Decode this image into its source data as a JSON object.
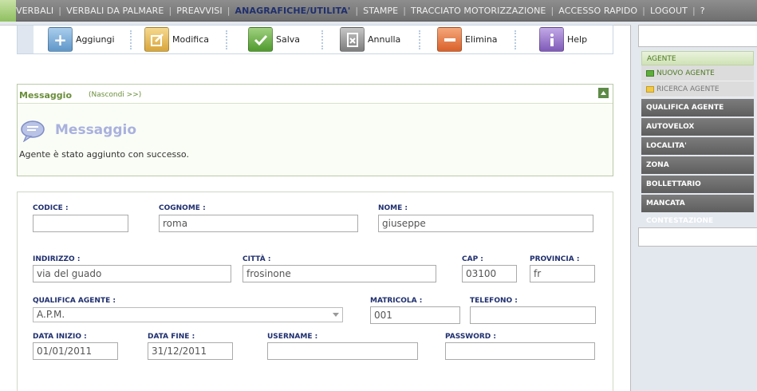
{
  "nav": {
    "items": [
      {
        "label": "VERBALI",
        "active": false
      },
      {
        "label": "VERBALI DA PALMARE",
        "active": false
      },
      {
        "label": "PREAVVISI",
        "active": false
      },
      {
        "label": "ANAGRAFICHE/UTILITA'",
        "active": true
      },
      {
        "label": "STAMPE",
        "active": false
      },
      {
        "label": "TRACCIATO MOTORIZZAZIONE",
        "active": false
      },
      {
        "label": "ACCESSO RAPIDO",
        "active": false
      },
      {
        "label": "LOGOUT",
        "active": false
      },
      {
        "label": "?",
        "active": false
      }
    ],
    "separator": "|"
  },
  "toolbar": {
    "add_label": "Aggiungi",
    "edit_label": "Modifica",
    "save_label": "Salva",
    "cancel_label": "Annulla",
    "delete_label": "Elimina",
    "help_label": "Help",
    "icons": [
      "plus-icon",
      "edit-icon",
      "checkmark-icon",
      "cancel-document-icon",
      "minus-icon",
      "info-icon"
    ],
    "colors": {
      "add": "#6fa6d4",
      "edit": "#e0b24a",
      "save": "#5fae3c",
      "cancel": "#8c8c8c",
      "delete": "#e2733a",
      "help": "#8f6bc1"
    }
  },
  "message": {
    "header_title": "Messaggio",
    "hide_link": "(Nascondi >>)",
    "title": "Messaggio",
    "text": "Agente è stato aggiunto con successo."
  },
  "form": {
    "codice": {
      "label": "CODICE :",
      "value": ""
    },
    "cognome": {
      "label": "COGNOME :",
      "value": "roma"
    },
    "nome": {
      "label": "NOME :",
      "value": "giuseppe"
    },
    "indirizzo": {
      "label": "INDIRIZZO :",
      "value": "via del guado"
    },
    "citta": {
      "label": "CITTÀ :",
      "value": "frosinone"
    },
    "cap": {
      "label": "CAP :",
      "value": "03100"
    },
    "provincia": {
      "label": "PROVINCIA :",
      "value": "fr"
    },
    "qualifica": {
      "label": "QUALIFICA AGENTE :",
      "value": "A.P.M."
    },
    "matricola": {
      "label": "MATRICOLA :",
      "value": "001"
    },
    "telefono": {
      "label": "TELEFONO :",
      "value": ""
    },
    "data_inizio": {
      "label": "DATA INIZIO :",
      "value": "01/01/2011"
    },
    "data_fine": {
      "label": "DATA FINE :",
      "value": "31/12/2011"
    },
    "username": {
      "label": "USERNAME :",
      "value": ""
    },
    "password": {
      "label": "PASSWORD :",
      "value": ""
    }
  },
  "sidebar": {
    "section": "AGENTE",
    "sub_items": [
      {
        "label": "NUOVO AGENTE",
        "selected": true,
        "color": "#5fae3c"
      },
      {
        "label": "RICERCA AGENTE",
        "selected": false,
        "color": "#e6b93c"
      }
    ],
    "items": [
      {
        "label": "QUALIFICA AGENTE"
      },
      {
        "label": "AUTOVELOX"
      },
      {
        "label": "LOCALITA'"
      },
      {
        "label": "ZONA"
      },
      {
        "label": "BOLLETTARIO"
      },
      {
        "label": "MANCATA CONTESTAZIONE"
      }
    ]
  }
}
